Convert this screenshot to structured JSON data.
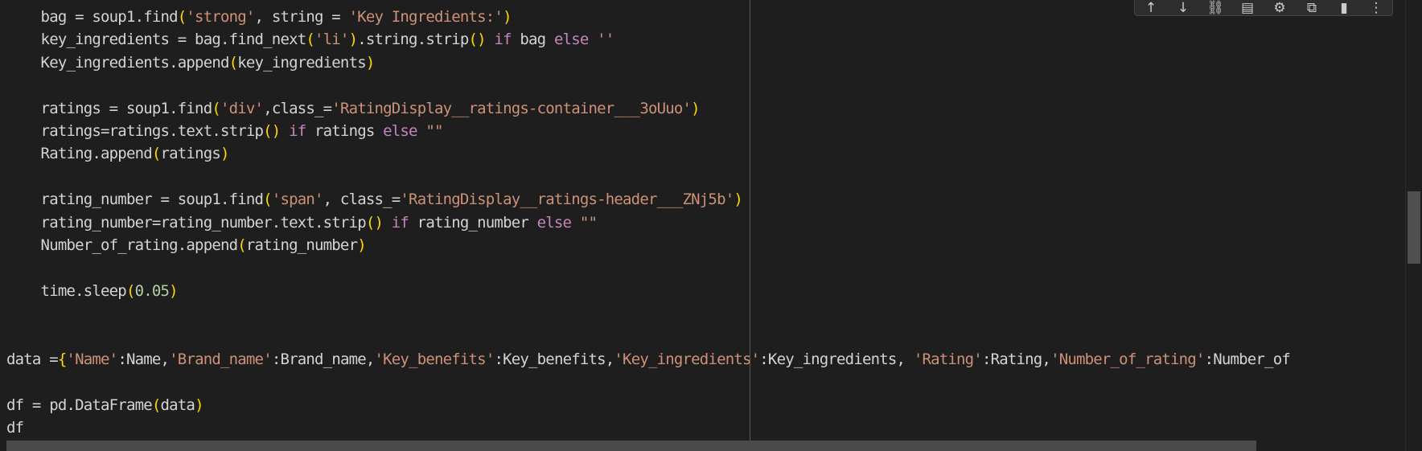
{
  "code_lines": [
    [
      {
        "t": "    bag = soup1.find"
      },
      {
        "t": "(",
        "c": "br"
      },
      {
        "t": "'strong'",
        "c": "str"
      },
      {
        "t": ", string = "
      },
      {
        "t": "'Key Ingredients:'",
        "c": "str"
      },
      {
        "t": ")",
        "c": "br"
      }
    ],
    [
      {
        "t": "    key_ingredients = bag.find_next"
      },
      {
        "t": "(",
        "c": "br"
      },
      {
        "t": "'li'",
        "c": "str"
      },
      {
        "t": ")",
        "c": "br"
      },
      {
        "t": ".string.strip"
      },
      {
        "t": "()",
        "c": "br"
      },
      {
        "t": " "
      },
      {
        "t": "if",
        "c": "kw"
      },
      {
        "t": " bag "
      },
      {
        "t": "else",
        "c": "kw"
      },
      {
        "t": " "
      },
      {
        "t": "''",
        "c": "str"
      }
    ],
    [
      {
        "t": "    Key_ingredients.append"
      },
      {
        "t": "(",
        "c": "br"
      },
      {
        "t": "key_ingredients"
      },
      {
        "t": ")",
        "c": "br"
      }
    ],
    [],
    [
      {
        "t": "    ratings = soup1.find"
      },
      {
        "t": "(",
        "c": "br"
      },
      {
        "t": "'div'",
        "c": "str"
      },
      {
        "t": ",class_="
      },
      {
        "t": "'RatingDisplay__ratings-container___3oUuo'",
        "c": "str"
      },
      {
        "t": ")",
        "c": "br"
      }
    ],
    [
      {
        "t": "    ratings=ratings.text.strip"
      },
      {
        "t": "()",
        "c": "br"
      },
      {
        "t": " "
      },
      {
        "t": "if",
        "c": "kw"
      },
      {
        "t": " ratings "
      },
      {
        "t": "else",
        "c": "kw"
      },
      {
        "t": " "
      },
      {
        "t": "\"\"",
        "c": "str"
      }
    ],
    [
      {
        "t": "    Rating.append"
      },
      {
        "t": "(",
        "c": "br"
      },
      {
        "t": "ratings"
      },
      {
        "t": ")",
        "c": "br"
      }
    ],
    [],
    [
      {
        "t": "    rating_number = soup1.find"
      },
      {
        "t": "(",
        "c": "br"
      },
      {
        "t": "'span'",
        "c": "str"
      },
      {
        "t": ", class_="
      },
      {
        "t": "'RatingDisplay__ratings-header___ZNj5b'",
        "c": "str"
      },
      {
        "t": ")",
        "c": "br"
      }
    ],
    [
      {
        "t": "    rating_number=rating_number.text.strip"
      },
      {
        "t": "()",
        "c": "br"
      },
      {
        "t": " "
      },
      {
        "t": "if",
        "c": "kw"
      },
      {
        "t": " rating_number "
      },
      {
        "t": "else",
        "c": "kw"
      },
      {
        "t": " "
      },
      {
        "t": "\"\"",
        "c": "str"
      }
    ],
    [
      {
        "t": "    Number_of_rating.append"
      },
      {
        "t": "(",
        "c": "br"
      },
      {
        "t": "rating_number"
      },
      {
        "t": ")",
        "c": "br"
      }
    ],
    [],
    [
      {
        "t": "    time.sleep"
      },
      {
        "t": "(",
        "c": "br"
      },
      {
        "t": "0.05",
        "c": "num"
      },
      {
        "t": ")",
        "c": "br"
      }
    ],
    [],
    [],
    [
      {
        "t": "data ="
      },
      {
        "t": "{",
        "c": "br"
      },
      {
        "t": "'Name'",
        "c": "str"
      },
      {
        "t": ":Name,"
      },
      {
        "t": "'Brand_name'",
        "c": "str"
      },
      {
        "t": ":Brand_name,"
      },
      {
        "t": "'Key_benefits'",
        "c": "str"
      },
      {
        "t": ":Key_benefits,"
      },
      {
        "t": "'Key_ingredients'",
        "c": "str"
      },
      {
        "t": ":Key_ingredients, "
      },
      {
        "t": "'Rating'",
        "c": "str"
      },
      {
        "t": ":Rating,"
      },
      {
        "t": "'Number_of_rating'",
        "c": "str"
      },
      {
        "t": ":Number_of"
      }
    ],
    [],
    [
      {
        "t": "df = pd.DataFrame"
      },
      {
        "t": "(",
        "c": "br"
      },
      {
        "t": "data"
      },
      {
        "t": ")",
        "c": "br"
      }
    ],
    [
      {
        "t": "df"
      }
    ]
  ],
  "toolbar_icons": [
    {
      "name": "move-up-icon",
      "glyph": "↑"
    },
    {
      "name": "move-down-icon",
      "glyph": "↓"
    },
    {
      "name": "link-icon",
      "glyph": "⛓"
    },
    {
      "name": "comment-icon",
      "glyph": "▤"
    },
    {
      "name": "gear-icon",
      "glyph": "⚙"
    },
    {
      "name": "open-in-editor-icon",
      "glyph": "⧉"
    },
    {
      "name": "delete-icon",
      "glyph": "▮"
    },
    {
      "name": "more-options-icon",
      "glyph": "⋮"
    }
  ],
  "colors": {
    "background": "#1e1e1e",
    "text": "#d4d4d4",
    "string": "#ce9178",
    "keyword": "#c586c0",
    "bracket": "#ffd700",
    "number": "#b5cea8"
  }
}
